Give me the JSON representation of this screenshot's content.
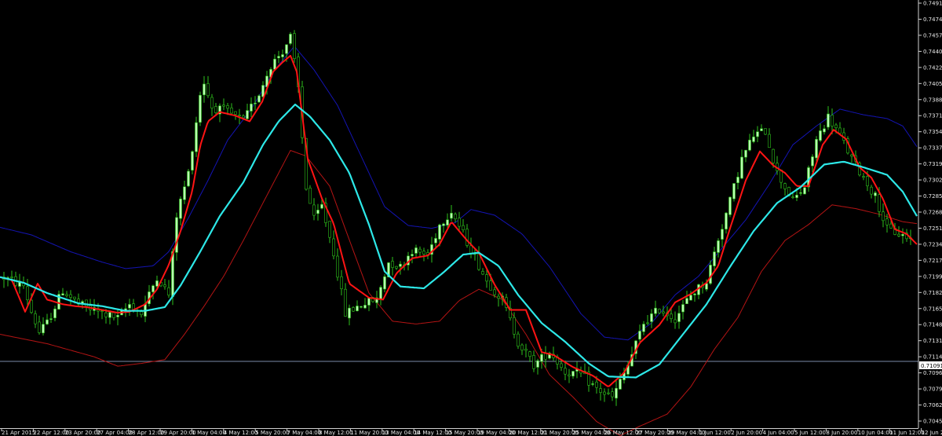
{
  "chart_data": {
    "type": "candlestick",
    "ylim": [
      0.70455,
      0.7491
    ],
    "yticks": [
      "0.74910",
      "0.74740",
      "0.74570",
      "0.74400",
      "0.74225",
      "0.74055",
      "0.73880",
      "0.73710",
      "0.73540",
      "0.73370",
      "0.73195",
      "0.73025",
      "0.72855",
      "0.72685",
      "0.72510",
      "0.72340",
      "0.72170",
      "0.71995",
      "0.71825",
      "0.71655",
      "0.71480",
      "0.71310",
      "0.71140",
      "0.70965",
      "0.70795",
      "0.70625",
      "0.70455"
    ],
    "xticks": [
      "21 Apr 2015",
      "22 Apr 12:00",
      "23 Apr 20:00",
      "27 Apr 04:00",
      "28 Apr 12:00",
      "29 Apr 20:00",
      "1 May 04:00",
      "4 May 12:00",
      "5 May 20:00",
      "7 May 04:00",
      "8 May 12:00",
      "11 May 20:00",
      "13 May 04:00",
      "14 May 12:00",
      "15 May 20:00",
      "19 May 04:00",
      "20 May 12:00",
      "21 May 20:00",
      "25 May 04:00",
      "26 May 12:00",
      "27 May 20:00",
      "29 May 04:00",
      "1 Jun 12:00",
      "2 Jun 20:00",
      "4 Jun 04:00",
      "5 Jun 12:00",
      "8 Jun 20:00",
      "10 Jun 04:00",
      "11 Jun 12:00",
      "12 Jun 20:00"
    ],
    "current_price": "0.71091",
    "current_price_value": 0.71091,
    "grid": false,
    "colors": {
      "background": "#000000",
      "bull_candle": "#b8ffb0",
      "bear_candle": "#000000",
      "wick": "#2ec21c",
      "fast_ma": "#ff1414",
      "slow_ma": "#2de8e8",
      "upper_band": "#1414b4",
      "lower_band": "#b41414",
      "price_line": "#7a8aa8",
      "axis": "#d0d0d0"
    },
    "series": [
      {
        "key": "fast_ma",
        "anchors": [
          [
            0,
            0.7199
          ],
          [
            15,
            0.7196
          ],
          [
            32,
            0.7162
          ],
          [
            48,
            0.7192
          ],
          [
            60,
            0.7175
          ],
          [
            80,
            0.717
          ],
          [
            96,
            0.7168
          ],
          [
            110,
            0.7167
          ],
          [
            130,
            0.7164
          ],
          [
            150,
            0.7161
          ],
          [
            165,
            0.7162
          ],
          [
            185,
            0.717
          ],
          [
            200,
            0.7186
          ],
          [
            215,
            0.7212
          ],
          [
            230,
            0.7248
          ],
          [
            245,
            0.7291
          ],
          [
            255,
            0.7339
          ],
          [
            265,
            0.7365
          ],
          [
            280,
            0.7375
          ],
          [
            300,
            0.7371
          ],
          [
            318,
            0.7365
          ],
          [
            334,
            0.7386
          ],
          [
            348,
            0.7418
          ],
          [
            360,
            0.7428
          ],
          [
            370,
            0.7435
          ],
          [
            378,
            0.7418
          ],
          [
            392,
            0.7325
          ],
          [
            410,
            0.7283
          ],
          [
            425,
            0.7256
          ],
          [
            445,
            0.7192
          ],
          [
            470,
            0.7177
          ],
          [
            488,
            0.7175
          ],
          [
            505,
            0.7203
          ],
          [
            525,
            0.7219
          ],
          [
            545,
            0.7222
          ],
          [
            560,
            0.7234
          ],
          [
            575,
            0.7258
          ],
          [
            595,
            0.7238
          ],
          [
            610,
            0.7225
          ],
          [
            630,
            0.7191
          ],
          [
            650,
            0.7164
          ],
          [
            670,
            0.7164
          ],
          [
            690,
            0.7119
          ],
          [
            705,
            0.7116
          ],
          [
            730,
            0.7103
          ],
          [
            755,
            0.7094
          ],
          [
            775,
            0.7082
          ],
          [
            795,
            0.7097
          ],
          [
            815,
            0.7129
          ],
          [
            840,
            0.7148
          ],
          [
            860,
            0.7172
          ],
          [
            880,
            0.7181
          ],
          [
            900,
            0.7193
          ],
          [
            915,
            0.7211
          ],
          [
            930,
            0.7251
          ],
          [
            950,
            0.7302
          ],
          [
            968,
            0.7333
          ],
          [
            985,
            0.7318
          ],
          [
            1000,
            0.731
          ],
          [
            1015,
            0.7296
          ],
          [
            1030,
            0.7296
          ],
          [
            1048,
            0.734
          ],
          [
            1062,
            0.7356
          ],
          [
            1078,
            0.7346
          ],
          [
            1095,
            0.7316
          ],
          [
            1110,
            0.7305
          ],
          [
            1125,
            0.7282
          ],
          [
            1140,
            0.725
          ],
          [
            1155,
            0.7245
          ],
          [
            1168,
            0.7234
          ]
        ]
      },
      {
        "key": "slow_ma",
        "anchors": [
          [
            0,
            0.7199
          ],
          [
            30,
            0.7193
          ],
          [
            60,
            0.7182
          ],
          [
            100,
            0.7171
          ],
          [
            130,
            0.7168
          ],
          [
            160,
            0.7163
          ],
          [
            185,
            0.7163
          ],
          [
            210,
            0.7167
          ],
          [
            230,
            0.719
          ],
          [
            255,
            0.7226
          ],
          [
            280,
            0.7264
          ],
          [
            310,
            0.73
          ],
          [
            335,
            0.734
          ],
          [
            355,
            0.7365
          ],
          [
            376,
            0.7383
          ],
          [
            395,
            0.737
          ],
          [
            420,
            0.7345
          ],
          [
            445,
            0.731
          ],
          [
            470,
            0.7255
          ],
          [
            490,
            0.7205
          ],
          [
            510,
            0.7189
          ],
          [
            540,
            0.7187
          ],
          [
            565,
            0.7204
          ],
          [
            590,
            0.7223
          ],
          [
            610,
            0.7225
          ],
          [
            635,
            0.7211
          ],
          [
            660,
            0.718
          ],
          [
            690,
            0.715
          ],
          [
            720,
            0.713
          ],
          [
            750,
            0.7107
          ],
          [
            775,
            0.7093
          ],
          [
            810,
            0.7092
          ],
          [
            840,
            0.7106
          ],
          [
            870,
            0.7138
          ],
          [
            900,
            0.717
          ],
          [
            930,
            0.721
          ],
          [
            960,
            0.7248
          ],
          [
            990,
            0.7278
          ],
          [
            1020,
            0.7295
          ],
          [
            1050,
            0.7319
          ],
          [
            1075,
            0.7322
          ],
          [
            1100,
            0.7316
          ],
          [
            1130,
            0.7308
          ],
          [
            1150,
            0.729
          ],
          [
            1168,
            0.7264
          ]
        ]
      },
      {
        "key": "upper_band",
        "anchors": [
          [
            0,
            0.7252
          ],
          [
            40,
            0.7244
          ],
          [
            90,
            0.7226
          ],
          [
            130,
            0.7215
          ],
          [
            160,
            0.7208
          ],
          [
            195,
            0.7211
          ],
          [
            215,
            0.7226
          ],
          [
            240,
            0.7262
          ],
          [
            265,
            0.7302
          ],
          [
            290,
            0.7345
          ],
          [
            320,
            0.7378
          ],
          [
            350,
            0.742
          ],
          [
            375,
            0.7445
          ],
          [
            400,
            0.742
          ],
          [
            430,
            0.7382
          ],
          [
            460,
            0.7328
          ],
          [
            490,
            0.7274
          ],
          [
            520,
            0.7254
          ],
          [
            550,
            0.7251
          ],
          [
            580,
            0.7257
          ],
          [
            600,
            0.7271
          ],
          [
            630,
            0.7265
          ],
          [
            665,
            0.7245
          ],
          [
            700,
            0.721
          ],
          [
            740,
            0.716
          ],
          [
            770,
            0.7135
          ],
          [
            800,
            0.7132
          ],
          [
            830,
            0.715
          ],
          [
            860,
            0.718
          ],
          [
            890,
            0.72
          ],
          [
            920,
            0.723
          ],
          [
            950,
            0.726
          ],
          [
            980,
            0.7298
          ],
          [
            1010,
            0.734
          ],
          [
            1040,
            0.736
          ],
          [
            1070,
            0.7378
          ],
          [
            1100,
            0.7372
          ],
          [
            1130,
            0.7368
          ],
          [
            1150,
            0.736
          ],
          [
            1168,
            0.7338
          ]
        ]
      },
      {
        "key": "lower_band",
        "anchors": [
          [
            0,
            0.7138
          ],
          [
            60,
            0.7128
          ],
          [
            120,
            0.7114
          ],
          [
            150,
            0.7104
          ],
          [
            180,
            0.7107
          ],
          [
            210,
            0.7111
          ],
          [
            235,
            0.7138
          ],
          [
            260,
            0.7168
          ],
          [
            285,
            0.72
          ],
          [
            310,
            0.7238
          ],
          [
            340,
            0.7286
          ],
          [
            370,
            0.7334
          ],
          [
            390,
            0.7328
          ],
          [
            420,
            0.7296
          ],
          [
            440,
            0.725
          ],
          [
            470,
            0.7182
          ],
          [
            500,
            0.7152
          ],
          [
            530,
            0.7149
          ],
          [
            560,
            0.7152
          ],
          [
            585,
            0.7174
          ],
          [
            610,
            0.7186
          ],
          [
            640,
            0.7175
          ],
          [
            670,
            0.7138
          ],
          [
            700,
            0.7095
          ],
          [
            730,
            0.7071
          ],
          [
            760,
            0.7045
          ],
          [
            790,
            0.703
          ],
          [
            815,
            0.704
          ],
          [
            850,
            0.7053
          ],
          [
            880,
            0.7082
          ],
          [
            910,
            0.7122
          ],
          [
            940,
            0.7156
          ],
          [
            970,
            0.7205
          ],
          [
            1000,
            0.7238
          ],
          [
            1030,
            0.7255
          ],
          [
            1060,
            0.7276
          ],
          [
            1090,
            0.7272
          ],
          [
            1120,
            0.7266
          ],
          [
            1150,
            0.7258
          ],
          [
            1168,
            0.7256
          ]
        ]
      }
    ],
    "candle_anchors": [
      [
        0,
        0.72
      ],
      [
        30,
        0.719
      ],
      [
        40,
        0.7162
      ],
      [
        50,
        0.714
      ],
      [
        60,
        0.715
      ],
      [
        80,
        0.7185
      ],
      [
        100,
        0.717
      ],
      [
        125,
        0.7162
      ],
      [
        150,
        0.7155
      ],
      [
        165,
        0.717
      ],
      [
        180,
        0.716
      ],
      [
        200,
        0.72
      ],
      [
        215,
        0.718
      ],
      [
        225,
        0.7265
      ],
      [
        240,
        0.731
      ],
      [
        250,
        0.7365
      ],
      [
        258,
        0.7412
      ],
      [
        270,
        0.738
      ],
      [
        290,
        0.7375
      ],
      [
        310,
        0.7365
      ],
      [
        330,
        0.7395
      ],
      [
        345,
        0.7425
      ],
      [
        360,
        0.744
      ],
      [
        370,
        0.7455
      ],
      [
        380,
        0.74
      ],
      [
        390,
        0.7295
      ],
      [
        400,
        0.726
      ],
      [
        410,
        0.7275
      ],
      [
        425,
        0.7225
      ],
      [
        440,
        0.716
      ],
      [
        460,
        0.717
      ],
      [
        480,
        0.7175
      ],
      [
        495,
        0.7215
      ],
      [
        510,
        0.721
      ],
      [
        525,
        0.7228
      ],
      [
        545,
        0.7222
      ],
      [
        560,
        0.7255
      ],
      [
        575,
        0.727
      ],
      [
        590,
        0.7245
      ],
      [
        605,
        0.722
      ],
      [
        620,
        0.7195
      ],
      [
        640,
        0.7175
      ],
      [
        660,
        0.713
      ],
      [
        680,
        0.7105
      ],
      [
        700,
        0.712
      ],
      [
        720,
        0.7098
      ],
      [
        740,
        0.7095
      ],
      [
        760,
        0.708
      ],
      [
        780,
        0.707
      ],
      [
        800,
        0.7105
      ],
      [
        820,
        0.715
      ],
      [
        840,
        0.7165
      ],
      [
        860,
        0.7155
      ],
      [
        880,
        0.718
      ],
      [
        900,
        0.7195
      ],
      [
        915,
        0.724
      ],
      [
        930,
        0.728
      ],
      [
        945,
        0.7325
      ],
      [
        960,
        0.735
      ],
      [
        975,
        0.7355
      ],
      [
        990,
        0.731
      ],
      [
        1010,
        0.728
      ],
      [
        1025,
        0.7295
      ],
      [
        1040,
        0.7345
      ],
      [
        1055,
        0.737
      ],
      [
        1070,
        0.735
      ],
      [
        1085,
        0.7325
      ],
      [
        1100,
        0.7305
      ],
      [
        1115,
        0.7285
      ],
      [
        1130,
        0.725
      ],
      [
        1145,
        0.7245
      ],
      [
        1160,
        0.724
      ],
      [
        1170,
        0.722
      ]
    ],
    "candles": {
      "count": 232,
      "start_x": 5,
      "step": 5
    }
  }
}
